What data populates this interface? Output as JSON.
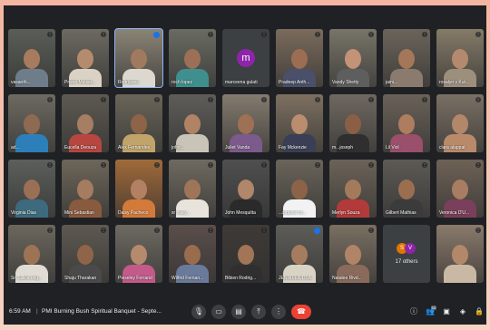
{
  "participants": [
    {
      "name": "vasanth...",
      "bg": "#5b5e57",
      "skin": "#a87b5e",
      "shirt": "#6f7d8b"
    },
    {
      "name": "Prison Ministr...",
      "bg": "#6d6a60",
      "skin": "#b58b6d",
      "shirt": "#d9d2c5"
    },
    {
      "name": "Rodrigues",
      "bg": "#8b8476",
      "skin": "#a07a5e",
      "shirt": "#dcd8d0",
      "speaking": true
    },
    {
      "name": "roch lopez",
      "bg": "#6a6b62",
      "skin": "#9c7056",
      "shirt": "#3e8f8d"
    },
    {
      "name": "marceena gulati",
      "avatar_letter": "m"
    },
    {
      "name": "Pradeep Anth...",
      "bg": "#7a6b5c",
      "skin": "#9b6d52",
      "shirt": "#4a4f6a"
    },
    {
      "name": "Vandy Shetty",
      "bg": "#787468",
      "skin": "#c39277",
      "shirt": "#5e5e5e"
    },
    {
      "name": "jaini...",
      "bg": "#6b645a",
      "skin": "#a37758",
      "shirt": "#8a7b6e"
    },
    {
      "name": "rosalyn v Kut...",
      "bg": "#857a68",
      "skin": "#b38a6e",
      "shirt": "#9c8f7c"
    },
    {
      "name": "ad...",
      "bg": "#6e6a61",
      "skin": "#8f6a52",
      "shirt": "#2c7fb8"
    },
    {
      "name": "Eucella Deouza",
      "bg": "#5e5a52",
      "skin": "#a67e63",
      "shirt": "#b6463f"
    },
    {
      "name": "Alex Fernandes",
      "bg": "#6a6559",
      "skin": "#8d6447",
      "shirt": "#c0a46a"
    },
    {
      "name": "john...",
      "bg": "#5f5d58",
      "skin": "#b08365",
      "shirt": "#c9c4b8"
    },
    {
      "name": "Juliet Vanda",
      "bg": "#847b6f",
      "skin": "#9e7054",
      "shirt": "#7d5a8c"
    },
    {
      "name": "Fay Mckenzie",
      "bg": "#7d7060",
      "skin": "#b98d6e",
      "shirt": "#3a3f55"
    },
    {
      "name": "m...joseph",
      "bg": "#6f6860",
      "skin": "#8a5f45",
      "shirt": "#2f2f2f"
    },
    {
      "name": "Lil Viol",
      "bg": "#6a6258",
      "skin": "#ae7d5f",
      "shirt": "#9a4f6a"
    },
    {
      "name": "clara alappat",
      "bg": "#7a7064",
      "skin": "#b2876a",
      "shirt": "#b98a6a"
    },
    {
      "name": "Virginia Dias",
      "bg": "#5c5f5b",
      "skin": "#9a7055",
      "shirt": "#3d6b7d"
    },
    {
      "name": "Mini Sebastian",
      "bg": "#6d665a",
      "skin": "#a57c60",
      "shirt": "#8a5a3e"
    },
    {
      "name": "Daisy Pacheco",
      "bg": "#a06a3a",
      "skin": "#b28163",
      "shirt": "#d37a3a"
    },
    {
      "name": "sr mary...",
      "bg": "#6f6a60",
      "skin": "#9f7559",
      "shirt": "#e8e4dc"
    },
    {
      "name": "John Mesquitta",
      "bg": "#4f4f4f",
      "skin": "#b0876a",
      "shirt": "#2a2a2a"
    },
    {
      "name": "...stopher th...",
      "bg": "#6a645a",
      "skin": "#8c6248",
      "shirt": "#f2f2f2"
    },
    {
      "name": "Merlyn Souza",
      "bg": "#6b6358",
      "skin": "#a47a5c",
      "shirt": "#b33a3a"
    },
    {
      "name": "Gilbert Mathias",
      "bg": "#5d5a55",
      "skin": "#9c6e50",
      "shirt": "#3b3b3b"
    },
    {
      "name": "Veronica D'U...",
      "bg": "#6e6256",
      "skin": "#a87d61",
      "shirt": "#7a3f5a"
    },
    {
      "name": "Sr. Sillica mig...",
      "bg": "#6c675d",
      "skin": "#9d7356",
      "shirt": "#e0dcd4"
    },
    {
      "name": "Shaju Tharakan",
      "bg": "#5e5951",
      "skin": "#8e6549",
      "shirt": "#4a4a4a"
    },
    {
      "name": "Pieseley Ferrand",
      "bg": "#6e6a62",
      "skin": "#b68b6d",
      "shirt": "#c35a8a"
    },
    {
      "name": "Wilfrid Fernan...",
      "bg": "#5a4e4a",
      "skin": "#9a6c4e",
      "shirt": "#6a7a9a"
    },
    {
      "name": "Bibien Rodrig...",
      "bg": "#3e3a36",
      "skin": "#a27557",
      "shirt": "#2f2f2f"
    },
    {
      "name": "JENNIFER DSA",
      "bg": "#5e5d58",
      "skin": "#a67c5e",
      "shirt": "#d9d3c6",
      "speaking_icon": true
    },
    {
      "name": "Natalee Rivd...",
      "bg": "#7a6f62",
      "skin": "#b08466",
      "shirt": "#8a6a5a"
    },
    {
      "name": "others",
      "others": true
    },
    {
      "name": "",
      "bg": "#8a7a6c",
      "skin": "#b3886a",
      "shirt": "#c9b9a4"
    }
  ],
  "others": {
    "label": "17 others",
    "avatars": [
      {
        "letter": "S",
        "color": "#e37400"
      },
      {
        "letter": "V",
        "color": "#8e24aa"
      }
    ]
  },
  "toolbar": {
    "time": "6:59 AM",
    "separator": "|",
    "meeting_title": "PMI Burning Bush Spiritual Banquet - Septe...",
    "buttons": [
      {
        "name": "mic-button",
        "icon": "mic-icon",
        "glyph": "🎙"
      },
      {
        "name": "camera-button",
        "icon": "camera-icon",
        "glyph": "▭"
      },
      {
        "name": "captions-button",
        "icon": "captions-icon",
        "glyph": "▤"
      },
      {
        "name": "present-button",
        "icon": "present-icon",
        "glyph": "⤒"
      },
      {
        "name": "more-options-button",
        "icon": "more-vert-icon",
        "glyph": "⋮"
      }
    ],
    "end_call_glyph": "☎",
    "right_buttons": [
      {
        "name": "info-button",
        "icon": "info-icon",
        "glyph": "ⓘ"
      },
      {
        "name": "people-button",
        "icon": "people-icon",
        "glyph": "👥",
        "badge": "53"
      },
      {
        "name": "chat-button",
        "icon": "chat-icon",
        "glyph": "▣"
      },
      {
        "name": "activities-button",
        "icon": "activities-icon",
        "glyph": "◈"
      },
      {
        "name": "host-controls-button",
        "icon": "lock-icon",
        "glyph": "🔒"
      }
    ]
  },
  "colors": {
    "end_call": "#ea4335",
    "speaking_outline": "#8ab4f8",
    "avatar_m": "#8e24aa"
  }
}
